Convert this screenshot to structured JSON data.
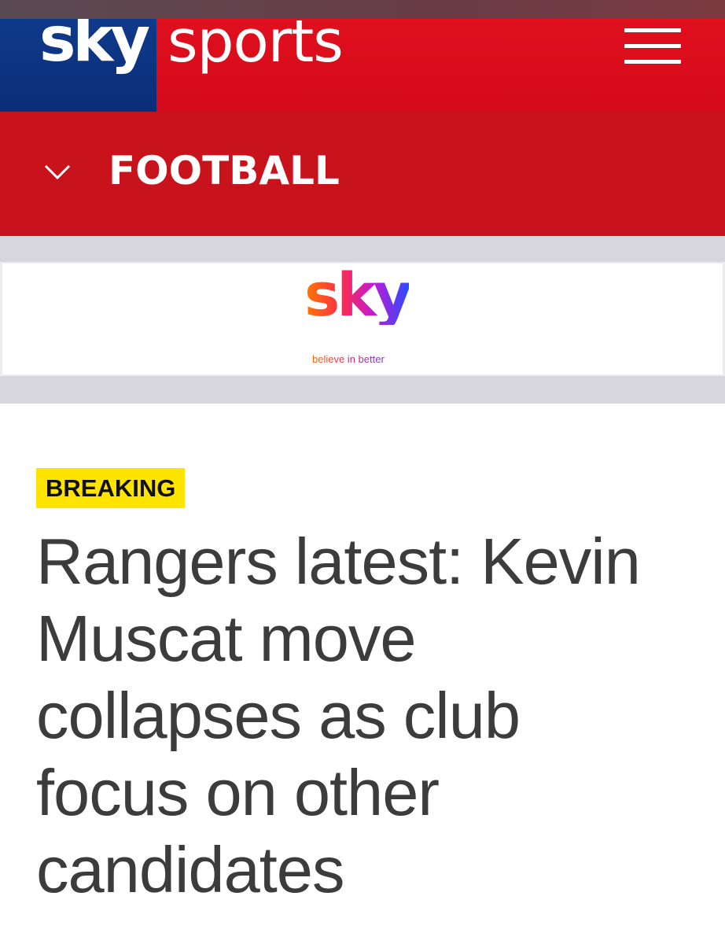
{
  "header": {
    "brand_sky": "sky",
    "brand_sports": "sports",
    "menu_icon": "hamburger-menu-icon"
  },
  "section_nav": {
    "label": "FOOTBALL",
    "icon": "chevron-down-icon"
  },
  "ad": {
    "logo_text": "sky",
    "tagline": "believe in better"
  },
  "article": {
    "badge": "BREAKING",
    "headline": "Rangers latest: Kevin Muscat move collapses as club focus on other candidates"
  },
  "colors": {
    "sky_blue": "#0a2e78",
    "sports_red": "#d40a1a",
    "section_red": "#c9131c",
    "breaking_yellow": "#ffe400",
    "headline_text": "#3c3c3c",
    "ad_background": "#d6d6dc"
  }
}
